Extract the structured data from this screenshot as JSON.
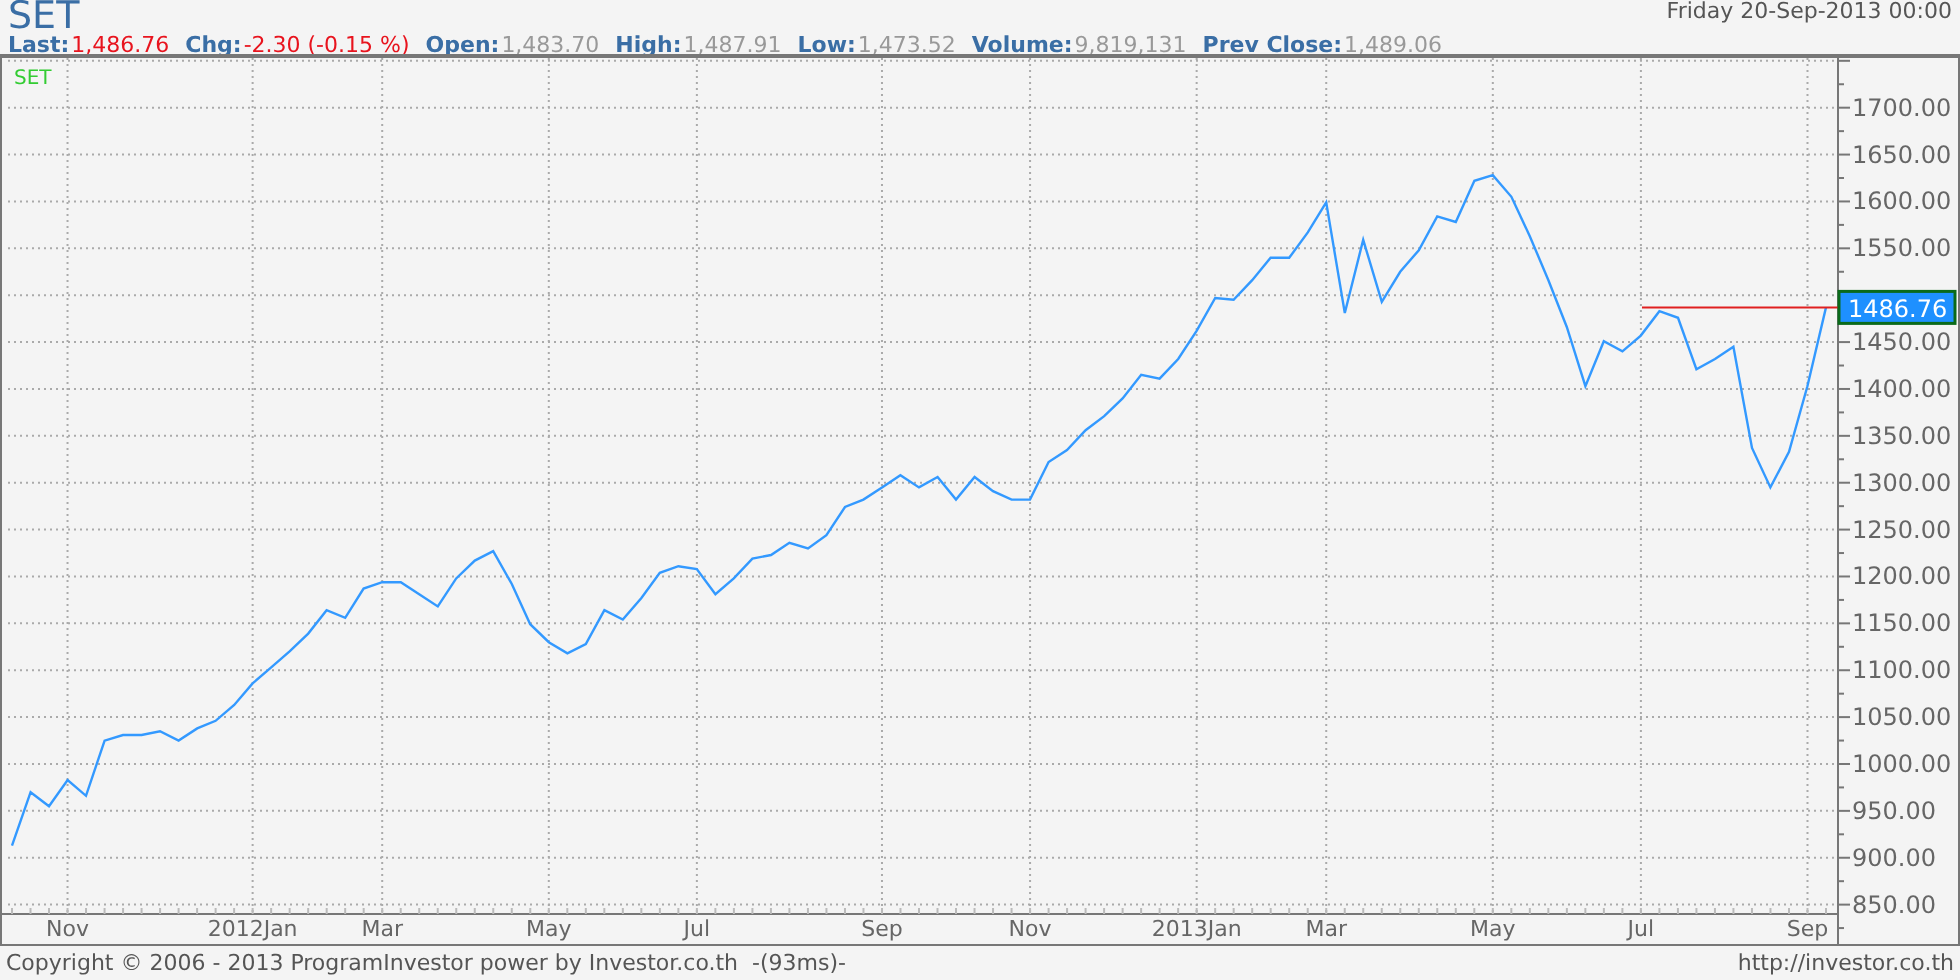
{
  "quote": {
    "symbol": "SET",
    "date": "Friday 20-Sep-2013 00:00",
    "stats": [
      {
        "label": "Last:",
        "value": "1,486.76",
        "kind": "change"
      },
      {
        "label": "Chg:",
        "value": "-2.30 (-0.15 %)",
        "kind": "change"
      },
      {
        "label": "Open:",
        "value": "1,483.70",
        "kind": "plain"
      },
      {
        "label": "High:",
        "value": "1,487.91",
        "kind": "plain"
      },
      {
        "label": "Low:",
        "value": "1,473.52",
        "kind": "plain"
      },
      {
        "label": "Volume:",
        "value": "9,819,131",
        "kind": "plain"
      },
      {
        "label": "Prev Close:",
        "value": "1,489.06",
        "kind": "plain"
      }
    ]
  },
  "chart": {
    "chart_data": {
      "type": "line",
      "categories": [
        null,
        null,
        null,
        "Nov",
        null,
        null,
        null,
        null,
        null,
        null,
        null,
        null,
        null,
        "2012Jan",
        null,
        null,
        null,
        null,
        null,
        null,
        "Mar",
        null,
        null,
        null,
        null,
        null,
        null,
        null,
        null,
        "May",
        null,
        null,
        null,
        null,
        null,
        null,
        null,
        "Jul",
        null,
        null,
        null,
        null,
        null,
        null,
        null,
        null,
        null,
        "Sep",
        null,
        null,
        null,
        null,
        null,
        null,
        null,
        "Nov",
        null,
        null,
        null,
        null,
        null,
        null,
        null,
        null,
        "2013Jan",
        null,
        null,
        null,
        null,
        null,
        null,
        "Mar",
        null,
        null,
        null,
        null,
        null,
        null,
        null,
        null,
        "May",
        null,
        null,
        null,
        null,
        null,
        null,
        null,
        "Jul",
        null,
        null,
        null,
        null,
        null,
        null,
        null,
        null,
        "Sep",
        null
      ],
      "series": [
        {
          "name": "SET",
          "color": "#3399ff",
          "values": [
            913,
            970,
            955,
            983,
            966,
            1025,
            1031,
            1031,
            1035,
            1025,
            1038,
            1046,
            1063,
            1086,
            1103,
            1120,
            1139,
            1164,
            1156,
            1187,
            1194,
            1194,
            1181,
            1168,
            1198,
            1217,
            1227,
            1192,
            1149,
            1130,
            1118,
            1128,
            1164,
            1154,
            1177,
            1204,
            1211,
            1208,
            1181,
            1198,
            1219,
            1223,
            1236,
            1230,
            1244,
            1274,
            1282,
            1295,
            1308,
            1295,
            1306,
            1282,
            1306,
            1291,
            1282,
            1282,
            1322,
            1335,
            1356,
            1371,
            1390,
            1415,
            1411,
            1432,
            1462,
            1497,
            1495,
            1516,
            1540,
            1540,
            1567,
            1599,
            1481,
            1559,
            1493,
            1525,
            1548,
            1584,
            1578,
            1622,
            1628,
            1605,
            1563,
            1516,
            1466,
            1403,
            1451,
            1440,
            1457,
            1483,
            1476,
            1421,
            1432,
            1445,
            1337,
            1295,
            1333,
            1403,
            1487
          ]
        }
      ],
      "ylim": [
        840,
        1753
      ],
      "yticks": [
        {
          "value": 850,
          "label": "850.00"
        },
        {
          "value": 900,
          "label": "900.00"
        },
        {
          "value": 950,
          "label": "950.00"
        },
        {
          "value": 1000,
          "label": "1000.00"
        },
        {
          "value": 1050,
          "label": "1050.00"
        },
        {
          "value": 1100,
          "label": "1100.00"
        },
        {
          "value": 1150,
          "label": "1150.00"
        },
        {
          "value": 1200,
          "label": "1200.00"
        },
        {
          "value": 1250,
          "label": "1250.00"
        },
        {
          "value": 1300,
          "label": "1300.00"
        },
        {
          "value": 1350,
          "label": "1350.00"
        },
        {
          "value": 1400,
          "label": "1400.00"
        },
        {
          "value": 1450,
          "label": "1450.00"
        },
        {
          "value": 1550,
          "label": "1550.00"
        },
        {
          "value": 1600,
          "label": "1600.00"
        },
        {
          "value": 1650,
          "label": "1650.00"
        },
        {
          "value": 1700,
          "label": "1700.00"
        }
      ],
      "grid": true,
      "ref_lines": [
        {
          "axis": "y",
          "value": 1487
        }
      ]
    },
    "last_price_badge": "1486.76"
  },
  "footer": {
    "copyright": "Copyright © 2006 - 2013 ProgramInvestor power by Investor.co.th  -(93ms)-",
    "link": "http://investor.co.th"
  }
}
